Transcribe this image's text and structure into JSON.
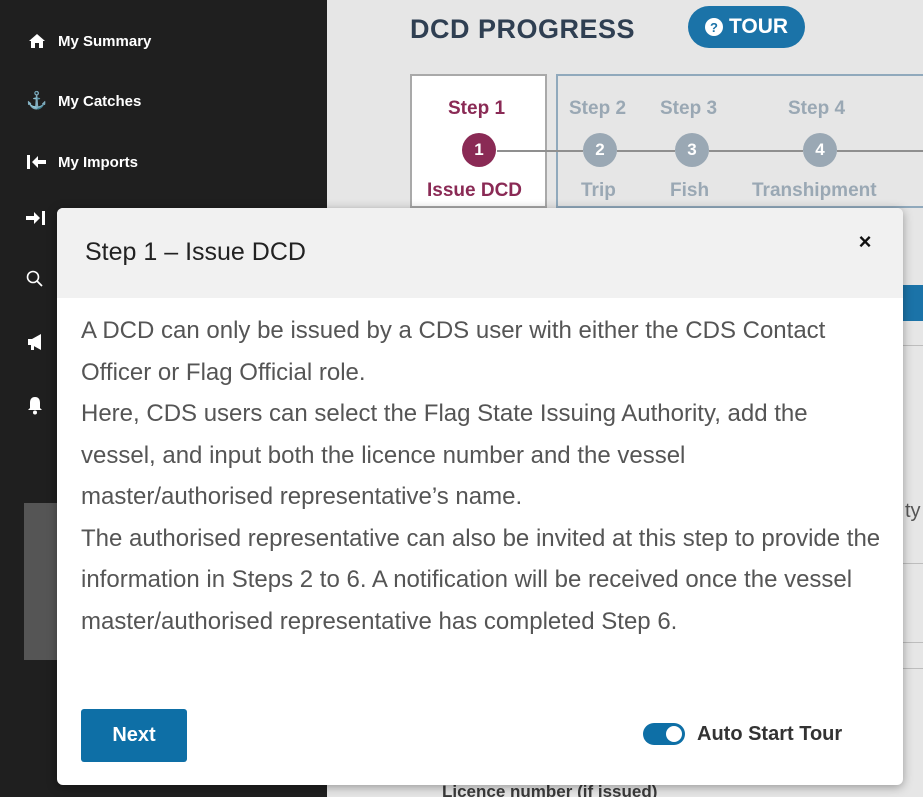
{
  "sidebar": {
    "items": [
      {
        "label": "My Summary",
        "icon": "home-icon"
      },
      {
        "label": "My Catches",
        "icon": "anchor-icon"
      },
      {
        "label": "My Imports",
        "icon": "import-arrow-icon"
      }
    ],
    "extra_icons": [
      "export-arrow-icon",
      "search-icon",
      "megaphone-icon",
      "bell-icon"
    ]
  },
  "main": {
    "title": "DCD PROGRESS",
    "tour_label": "TOUR",
    "tour_icon": "question-icon",
    "steps": [
      {
        "label": "Step 1",
        "number": "1",
        "name": "Issue DCD",
        "active": true
      },
      {
        "label": "Step 2",
        "number": "2",
        "name": "Trip",
        "active": false
      },
      {
        "label": "Step 3",
        "number": "3",
        "name": "Fish",
        "active": false
      },
      {
        "label": "Step 4",
        "number": "4",
        "name": "Transhipment",
        "active": false
      }
    ],
    "fragment_text": "ty",
    "bottom_text": "Licence number (if issued)"
  },
  "modal": {
    "title": "Step 1 – Issue DCD",
    "close_symbol": "×",
    "paragraphs": [
      "A DCD can only be issued by a CDS user with either the CDS Contact Officer or Flag Official role.",
      "Here, CDS users can select the Flag State Issuing Authority, add the vessel, and input both the licence number and the vessel master/authorised representative’s name.",
      "The authorised representative can also be invited at this step to provide the information in Steps 2 to 6. A notification will be received once the vessel master/authorised representative has completed Step 6."
    ],
    "next_label": "Next",
    "auto_start_label": "Auto Start Tour",
    "auto_start_enabled": true
  },
  "colors": {
    "primary": "#0e6fa6",
    "active_step": "#8a2a55",
    "sidebar_bg": "#1f1f1f"
  }
}
